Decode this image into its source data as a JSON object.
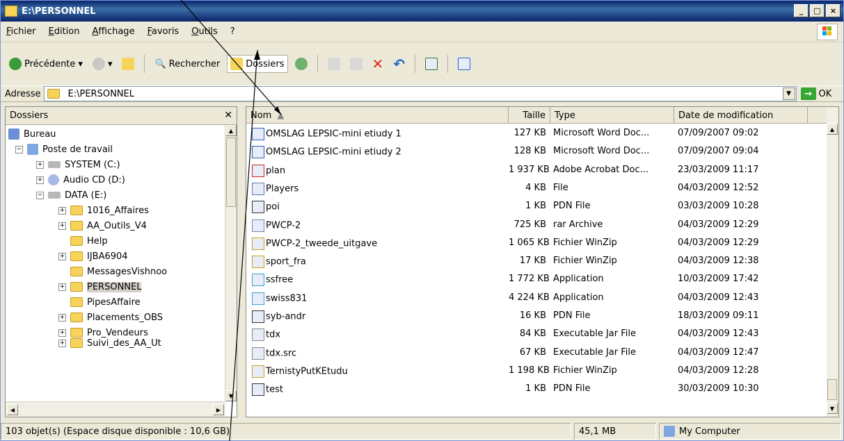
{
  "window": {
    "title": "E:\\PERSONNEL"
  },
  "menu": [
    "Fichier",
    "Edition",
    "Affichage",
    "Favoris",
    "Outils",
    "?"
  ],
  "toolbar": {
    "back": "Précédente",
    "search": "Rechercher",
    "folders": "Dossiers"
  },
  "address": {
    "label": "Adresse",
    "value": "E:\\PERSONNEL",
    "go": "OK"
  },
  "folders_pane": {
    "title": "Dossiers",
    "items": [
      "Bureau",
      "Poste de travail",
      "SYSTEM (C:)",
      "Audio CD (D:)",
      "DATA (E:)",
      "1016_Affaires",
      "AA_Outils_V4",
      "Help",
      "IJBA6904",
      "MessagesVishnoo",
      "PERSONNEL",
      "PipesAffaire",
      "Placements_OBS",
      "Pro_Vendeurs",
      "Suivi_des_AA_Ut"
    ]
  },
  "columns": {
    "name": "Nom",
    "size": "Taille",
    "type": "Type",
    "date": "Date de modification"
  },
  "files": [
    {
      "name": "OMSLAG  LEPSIC-mini etiudy 1",
      "size": "127 KB",
      "type": "Microsoft Word Doc...",
      "date": "07/09/2007 09:02"
    },
    {
      "name": "OMSLAG  LEPSIC-mini etiudy 2",
      "size": "128 KB",
      "type": "Microsoft Word Doc...",
      "date": "07/09/2007 09:04"
    },
    {
      "name": "plan",
      "size": "1 937 KB",
      "type": "Adobe Acrobat Doc...",
      "date": "23/03/2009 11:17"
    },
    {
      "name": "Players",
      "size": "4 KB",
      "type": "File",
      "date": "04/03/2009 12:52"
    },
    {
      "name": "poi",
      "size": "1 KB",
      "type": "PDN File",
      "date": "03/03/2009 10:28"
    },
    {
      "name": "PWCP-2",
      "size": "725 KB",
      "type": "rar Archive",
      "date": "04/03/2009 12:29"
    },
    {
      "name": "PWCP-2_tweede_uitgave",
      "size": "1 065 KB",
      "type": "Fichier WinZip",
      "date": "04/03/2009 12:29"
    },
    {
      "name": "sport_fra",
      "size": "17 KB",
      "type": "Fichier WinZip",
      "date": "04/03/2009 12:38"
    },
    {
      "name": "ssfree",
      "size": "1 772 KB",
      "type": "Application",
      "date": "10/03/2009 17:42"
    },
    {
      "name": "swiss831",
      "size": "4 224 KB",
      "type": "Application",
      "date": "04/03/2009 12:43"
    },
    {
      "name": "syb-andr",
      "size": "16 KB",
      "type": "PDN File",
      "date": "18/03/2009 09:11"
    },
    {
      "name": "tdx",
      "size": "84 KB",
      "type": "Executable Jar File",
      "date": "04/03/2009 12:43"
    },
    {
      "name": "tdx.src",
      "size": "67 KB",
      "type": "Executable Jar File",
      "date": "04/03/2009 12:47"
    },
    {
      "name": "TernistyPutKEtudu",
      "size": "1 198 KB",
      "type": "Fichier WinZip",
      "date": "04/03/2009 12:28"
    },
    {
      "name": "test",
      "size": "1 KB",
      "type": "PDN File",
      "date": "30/03/2009 10:30"
    }
  ],
  "status": {
    "objects": "103 objet(s) (Espace disque disponible : 10,6 GB)",
    "size": "45,1 MB",
    "location": "My Computer"
  }
}
